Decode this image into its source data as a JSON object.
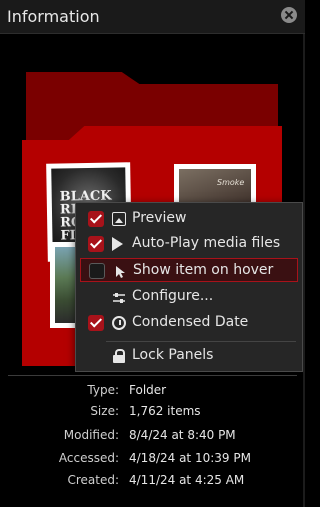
{
  "panel": {
    "title": "Information"
  },
  "preview": {
    "album_art_text": "BLACK REBEL ROOTS FIRE",
    "thumb_b_text": "Smoke"
  },
  "context_menu": {
    "items": [
      {
        "label": "Preview",
        "checked": true,
        "icon": "image-icon"
      },
      {
        "label": "Auto-Play media files",
        "checked": true,
        "icon": "play-icon"
      },
      {
        "label": "Show item on hover",
        "checked": false,
        "icon": "cursor-icon",
        "highlighted": true
      },
      {
        "label": "Configure...",
        "icon": "settings-icon"
      },
      {
        "label": "Condensed Date",
        "checked": true,
        "icon": "clock-icon"
      },
      {
        "label": "Lock Panels",
        "icon": "lock-icon"
      }
    ]
  },
  "info": {
    "rows": [
      {
        "key": "Type:",
        "value": "Folder"
      },
      {
        "key": "Size:",
        "value": "1,762 items"
      },
      {
        "key": "Modified:",
        "value": "8/4/24 at 8:40 PM"
      },
      {
        "key": "Accessed:",
        "value": "4/18/24 at 10:39 PM"
      },
      {
        "key": "Created:",
        "value": "4/11/24 at 4:25 AM"
      }
    ]
  },
  "colors": {
    "accent": "#a8121a",
    "folder": "#b40000",
    "background": "#000000"
  }
}
